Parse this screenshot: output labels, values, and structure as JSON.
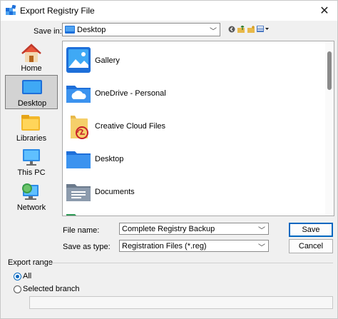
{
  "window": {
    "title": "Export Registry File",
    "close_glyph": "✕"
  },
  "save_in": {
    "label": "Save in:",
    "value": "Desktop"
  },
  "toolbar": {
    "back_icon": "back-icon",
    "up_icon": "up-folder-icon",
    "new_folder_icon": "new-folder-icon",
    "view_icon": "view-menu-icon"
  },
  "places": [
    {
      "label": "Home",
      "icon": "home-icon"
    },
    {
      "label": "Desktop",
      "icon": "desktop-icon",
      "selected": true
    },
    {
      "label": "Libraries",
      "icon": "libraries-icon"
    },
    {
      "label": "This PC",
      "icon": "this-pc-icon"
    },
    {
      "label": "Network",
      "icon": "network-icon"
    }
  ],
  "files": [
    {
      "name": "Gallery",
      "icon": "gallery-icon"
    },
    {
      "name": "OneDrive - Personal",
      "icon": "onedrive-folder-icon"
    },
    {
      "name": "Creative Cloud Files",
      "icon": "creative-cloud-folder-icon"
    },
    {
      "name": "Desktop",
      "icon": "desktop-folder-icon"
    },
    {
      "name": "Documents",
      "icon": "documents-folder-icon"
    }
  ],
  "file_name": {
    "label": "File name:",
    "value": "Complete Registry Backup"
  },
  "save_as_type": {
    "label": "Save as type:",
    "value": "Registration Files (*.reg)"
  },
  "buttons": {
    "save": "Save",
    "cancel": "Cancel"
  },
  "export_range": {
    "title": "Export range",
    "options": [
      {
        "label": "All",
        "selected": true
      },
      {
        "label": "Selected branch",
        "selected": false
      }
    ],
    "branch_value": ""
  },
  "colors": {
    "accent": "#0067c0",
    "folder_blue": "#1e6fd9",
    "selection": "#d3d3d3"
  }
}
